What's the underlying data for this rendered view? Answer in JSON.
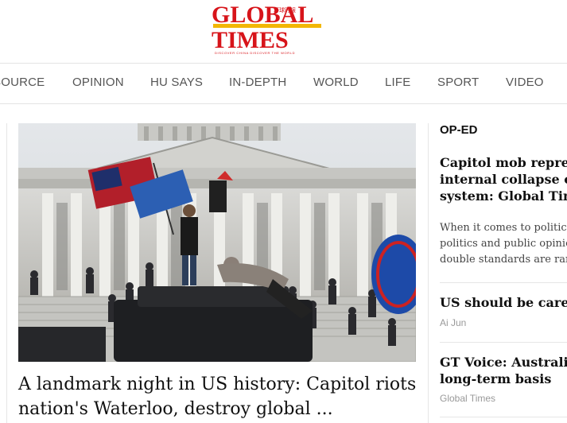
{
  "logo": {
    "line1": "GLOBAL",
    "line2": "TIMES",
    "chinese": "环球时报",
    "tagline": "DISCOVER CHINA DISCOVER THE WORLD"
  },
  "nav": {
    "items": [
      "SOURCE",
      "OPINION",
      "HU SAYS",
      "IN-DEPTH",
      "WORLD",
      "LIFE",
      "SPORT",
      "VIDEO"
    ]
  },
  "featured": {
    "headline_line1": "A landmark night in US history: Capitol riots",
    "headline_line2": "nation's Waterloo, destroy global ..."
  },
  "op_ed": {
    "label": "OP-ED",
    "lead": {
      "title_lines": [
        "Capitol mob represen",
        "internal collapse of U",
        "system: Global Times"
      ],
      "summary_lines": [
        "When it comes to politics, t",
        "politics and public opinion",
        "double standards are rampa"
      ]
    },
    "items": [
      {
        "title_lines": [
          "US should be careful"
        ],
        "byline": "Ai Jun"
      },
      {
        "title_lines": [
          "GT Voice: Australia t",
          "long-term basis"
        ],
        "byline": "Global Times"
      }
    ]
  },
  "colors": {
    "brand_red": "#d7141a",
    "brand_gold": "#f2b705",
    "nav_text": "#555555"
  }
}
